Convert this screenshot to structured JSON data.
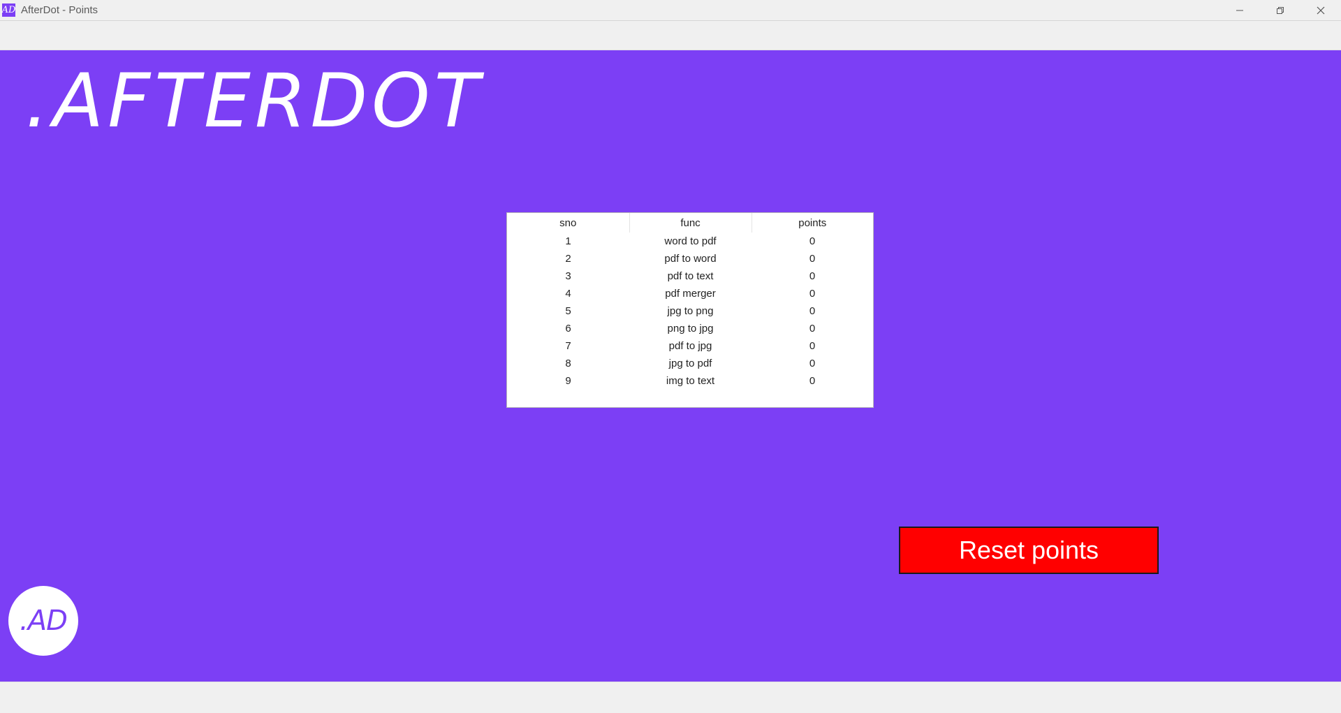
{
  "window": {
    "title": "AfterDot - Points",
    "icon_label": "AD"
  },
  "brand": {
    "title": ".AFTERDOT",
    "logo_text": ".AD"
  },
  "colors": {
    "accent": "#7c3ff5",
    "reset_button": "#ff0000"
  },
  "table": {
    "headers": [
      "sno",
      "func",
      "points"
    ],
    "rows": [
      [
        "1",
        "word to pdf",
        "0"
      ],
      [
        "2",
        "pdf to word",
        "0"
      ],
      [
        "3",
        "pdf to text",
        "0"
      ],
      [
        "4",
        "pdf merger",
        "0"
      ],
      [
        "5",
        "jpg to png",
        "0"
      ],
      [
        "6",
        "png to jpg",
        "0"
      ],
      [
        "7",
        "pdf to jpg",
        "0"
      ],
      [
        "8",
        "jpg to pdf",
        "0"
      ],
      [
        "9",
        "img to text",
        "0"
      ]
    ]
  },
  "actions": {
    "reset_label": "Reset points"
  }
}
